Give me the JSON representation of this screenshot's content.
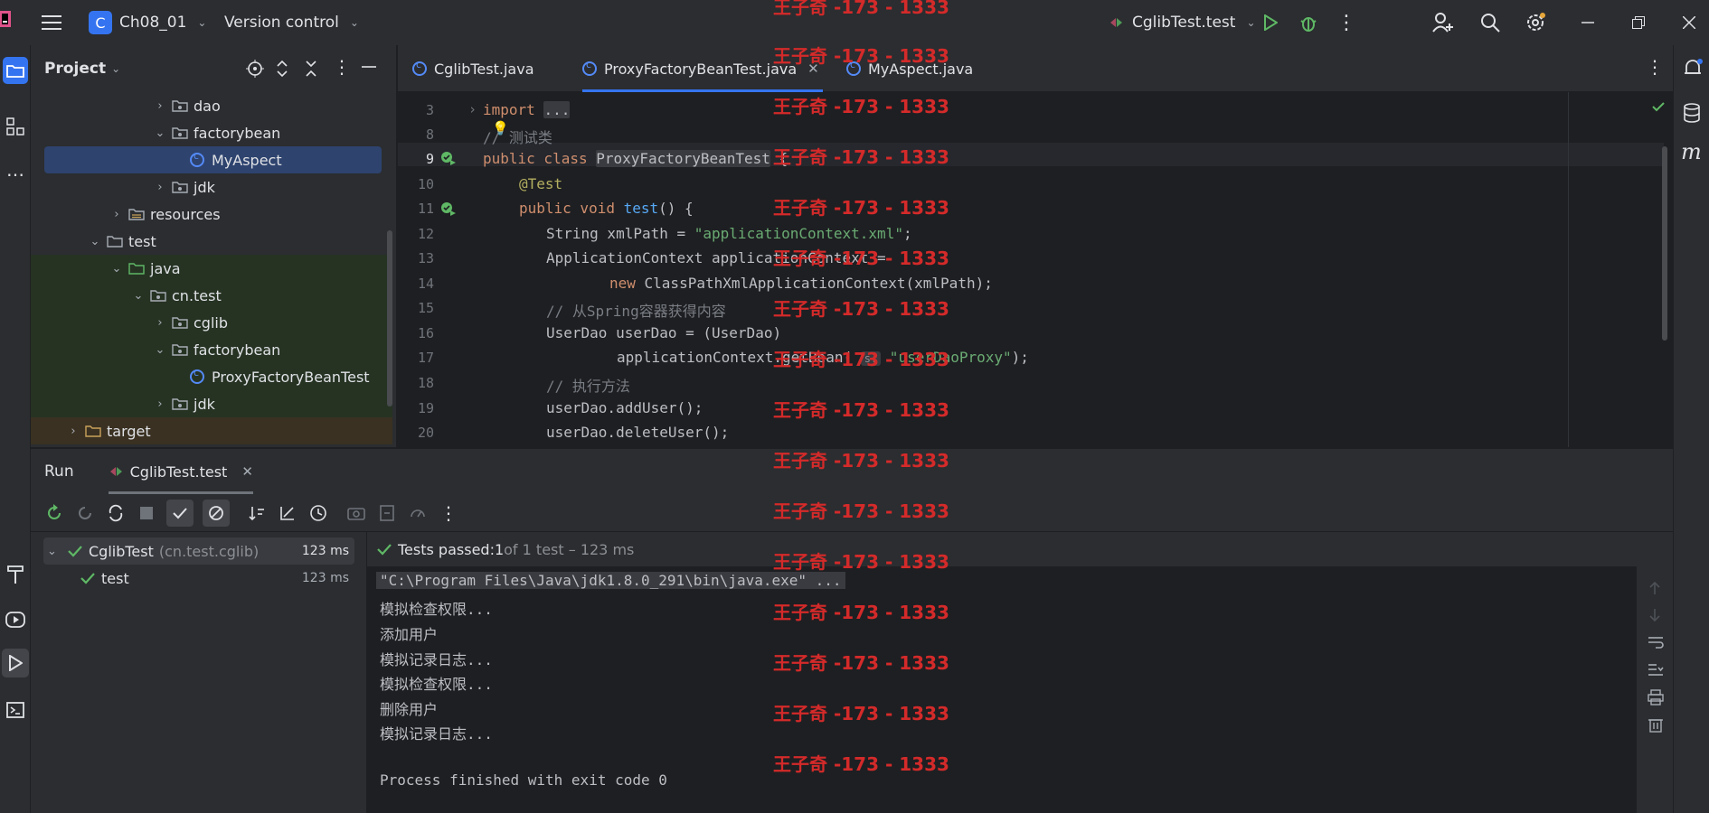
{
  "titlebar": {
    "project_badge": "C",
    "project_name": "Ch08_01",
    "vcs_label": "Version control",
    "run_config": "CglibTest.test"
  },
  "project_panel": {
    "title": "Project",
    "tree": [
      {
        "label": "dao",
        "indent": 6,
        "expanded": false,
        "type": "package"
      },
      {
        "label": "factorybean",
        "indent": 6,
        "expanded": true,
        "type": "package"
      },
      {
        "label": "MyAspect",
        "indent": 7,
        "type": "class",
        "selected": true
      },
      {
        "label": "jdk",
        "indent": 6,
        "expanded": false,
        "type": "package"
      },
      {
        "label": "resources",
        "indent": 4,
        "expanded": false,
        "type": "resources"
      },
      {
        "label": "test",
        "indent": 3,
        "expanded": true,
        "type": "folder"
      },
      {
        "label": "java",
        "indent": 4,
        "expanded": true,
        "type": "test-folder"
      },
      {
        "label": "cn.test",
        "indent": 5,
        "expanded": true,
        "type": "package"
      },
      {
        "label": "cglib",
        "indent": 6,
        "expanded": false,
        "type": "package"
      },
      {
        "label": "factorybean",
        "indent": 6,
        "expanded": true,
        "type": "package"
      },
      {
        "label": "ProxyFactoryBeanTest",
        "indent": 7,
        "type": "class"
      },
      {
        "label": "jdk",
        "indent": 6,
        "expanded": false,
        "type": "package"
      },
      {
        "label": "target",
        "indent": 2,
        "expanded": false,
        "type": "excluded"
      }
    ]
  },
  "editor": {
    "tabs": [
      {
        "label": "CglibTest.java",
        "active": false
      },
      {
        "label": "ProxyFactoryBeanTest.java",
        "active": true
      },
      {
        "label": "MyAspect.java",
        "active": false
      }
    ],
    "line_numbers": [
      "3",
      "8",
      "9",
      "10",
      "11",
      "12",
      "13",
      "14",
      "15",
      "16",
      "17",
      "18",
      "19",
      "20"
    ],
    "code": {
      "l3_kw": "import",
      "l3_fold": "...",
      "l8": "// 测试类",
      "l9_a": "public class ",
      "l9_b": "ProxyFactoryBeanTest",
      "l9_c": " {",
      "l10": "@Test",
      "l11_a": "public void ",
      "l11_b": "test",
      "l11_c": "() {",
      "l12_a": "String xmlPath = ",
      "l12_b": "\"applicationContext.xml\"",
      "l12_c": ";",
      "l13": "ApplicationContext applicationContext =",
      "l14_a": "new ",
      "l14_b": "ClassPathXmlApplicationContext(xmlPath);",
      "l15": "// 从Spring容器获得内容",
      "l16": "UserDao userDao = (UserDao)",
      "l17_a": "applicationContext.getBean( ",
      "l17_hint": "s:",
      "l17_b": " \"userDaoProxy\"",
      "l17_c": ");",
      "l18": "// 执行方法",
      "l19": "userDao.addUser();",
      "l20": "userDao.deleteUser();"
    }
  },
  "run": {
    "tab_run": "Run",
    "tab_config": "CglibTest.test",
    "tree": [
      {
        "label": "CglibTest",
        "sub": "(cn.test.cglib)",
        "time": "123 ms"
      },
      {
        "label": "test",
        "time": "123 ms"
      }
    ],
    "status_prefix": "Tests passed: ",
    "status_count": "1",
    "status_suffix": " of 1 test – 123 ms",
    "console": [
      "\"C:\\Program Files\\Java\\jdk1.8.0_291\\bin\\java.exe\" ...",
      "模拟检查权限...",
      "添加用户",
      "模拟记录日志...",
      "模拟检查权限...",
      "删除用户",
      "模拟记录日志...",
      "",
      "Process finished with exit code 0"
    ]
  },
  "watermark": "王子奇 -173 - 1333",
  "colors": {
    "accent": "#3574f0",
    "success": "#5fb865",
    "keyword": "#cf8e6d",
    "string": "#6aab73",
    "watermark": "#d42a2a"
  }
}
